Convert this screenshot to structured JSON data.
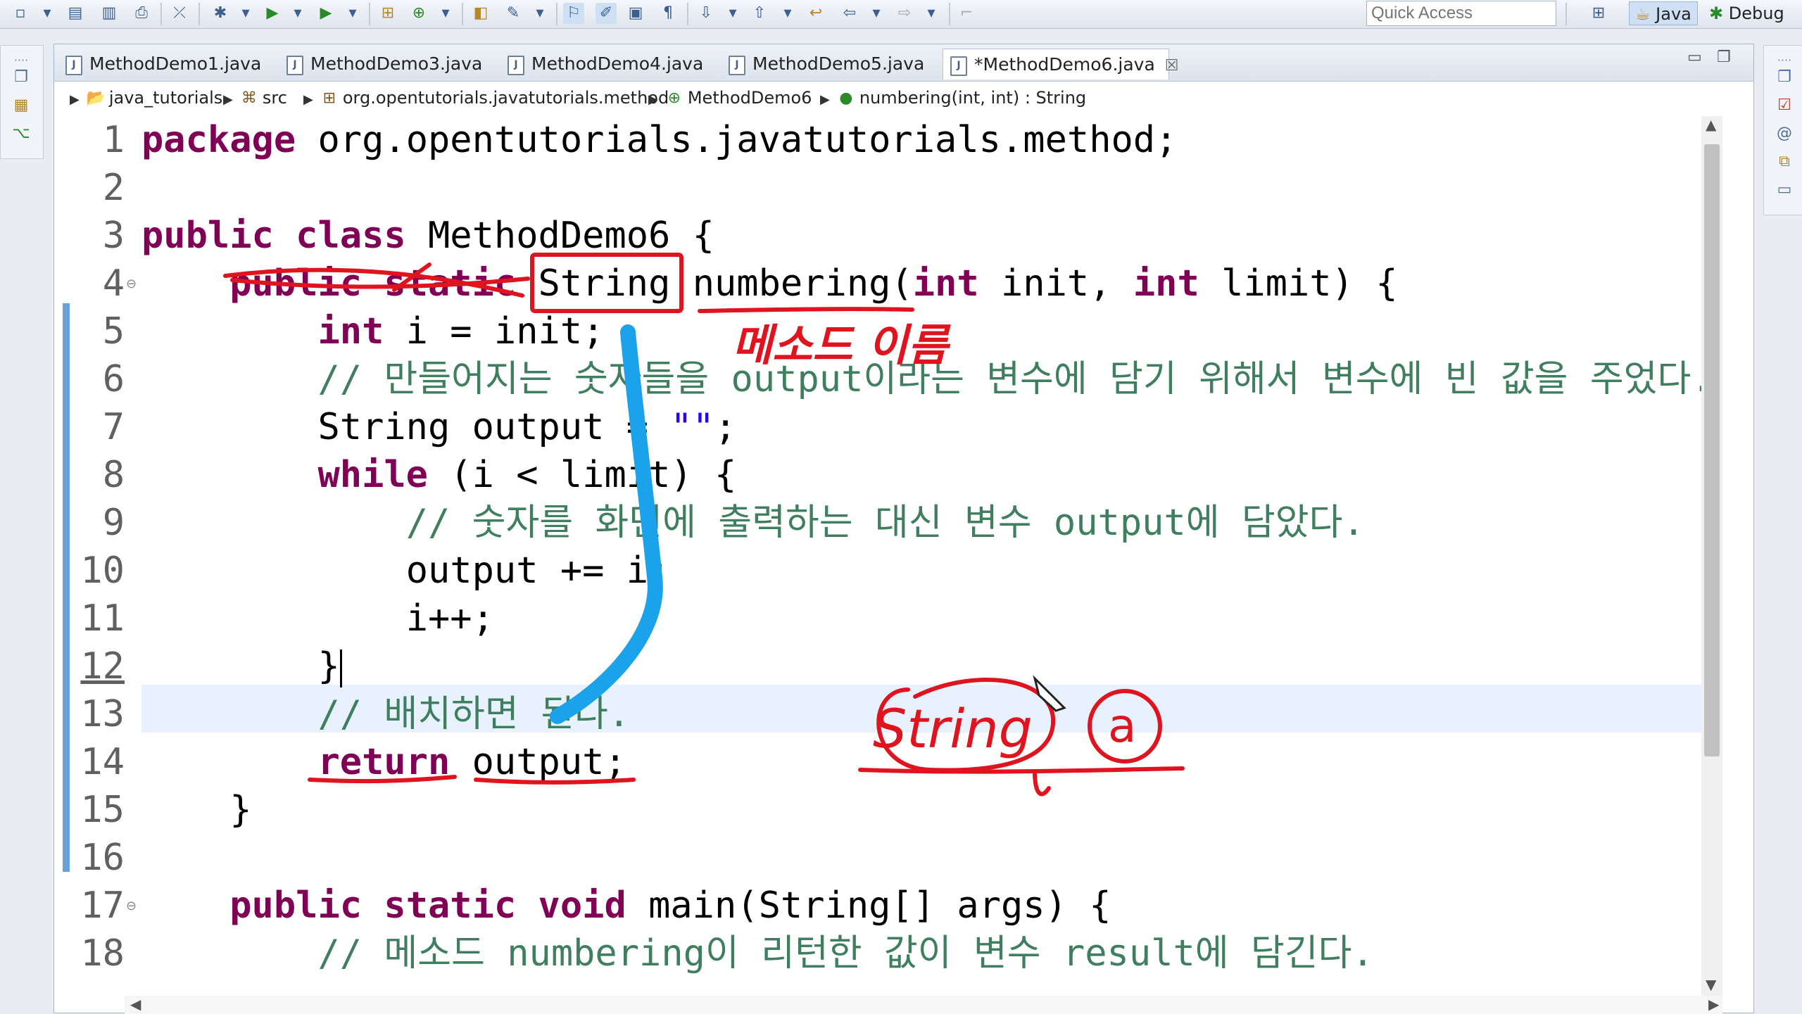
{
  "toolbar": {
    "quick_access_placeholder": "Quick Access",
    "perspectives": [
      "Java",
      "Debug"
    ]
  },
  "tabs": [
    {
      "label": "MethodDemo1.java"
    },
    {
      "label": "MethodDemo3.java"
    },
    {
      "label": "MethodDemo4.java"
    },
    {
      "label": "MethodDemo5.java"
    },
    {
      "label": "*MethodDemo6.java",
      "close": "☒"
    }
  ],
  "breadcrumb": [
    "java_tutorials",
    "src",
    "org.opentutorials.javatutorials.method",
    "MethodDemo6",
    "numbering(int, int) : String"
  ],
  "code": {
    "line_numbers": [
      "1",
      "2",
      "3",
      "4",
      "5",
      "6",
      "7",
      "8",
      "9",
      "10",
      "11",
      "12",
      "13",
      "14",
      "15",
      "16",
      "17",
      "18"
    ],
    "l1_kw": "package",
    "l1_rest": " org.opentutorials.javatutorials.method;",
    "l3_kw": "public class",
    "l3_rest": " MethodDemo6 {",
    "l4_kw1": "public static",
    "l4_t1": " String numbering(",
    "l4_kw2": "int",
    "l4_t2": " init, ",
    "l4_kw3": "int",
    "l4_t3": " limit) {",
    "l5_kw": "int",
    "l5_rest": " i = init;",
    "l6_cm": "// 만들어지는 숫자들을 output이라는 변수에 담기 위해서 변수에 빈 값을 주었다.",
    "l7_a": "String output = ",
    "l7_str": "\"\"",
    "l7_b": ";",
    "l8_kw": "while",
    "l8_rest": " (i < limit) {",
    "l9_cm": "// 숫자를 화면에 출력하는 대신 변수 output에 담았다.",
    "l10": "output += i;",
    "l11": "i++;",
    "l12": "}",
    "l13_cm": "// 배치하면 된다.",
    "l14_kw": "return",
    "l14_rest": " output;",
    "l15": "}",
    "l17_kw": "public static void",
    "l17_rest": " main(String[] args) {",
    "l18_cm": "// 메소드 numbering이 리턴한 값이 변수 result에 담긴다."
  },
  "annotations": {
    "method_name_note": "메소드 이름",
    "sketch_type": "String",
    "sketch_var": "a"
  },
  "colors": {
    "keyword": "#7f0055",
    "comment": "#3f7f5f",
    "string": "#2a00ff",
    "ink_red": "#e0141e",
    "ink_blue": "#1aa3ea"
  }
}
